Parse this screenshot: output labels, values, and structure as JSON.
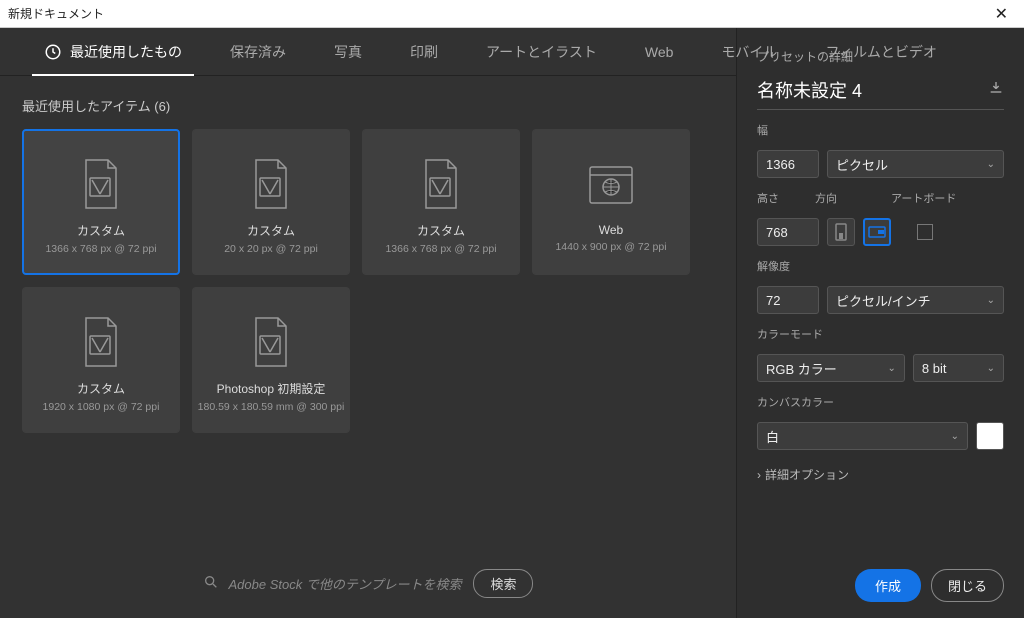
{
  "window": {
    "title": "新規ドキュメント"
  },
  "tabs": {
    "recent": "最近使用したもの",
    "saved": "保存済み",
    "photo": "写真",
    "print": "印刷",
    "art": "アートとイラスト",
    "web": "Web",
    "mobile": "モバイル",
    "film": "フィルムとビデオ"
  },
  "recentItems": {
    "heading": "最近使用したアイテム  (6)",
    "items": [
      {
        "title": "カスタム",
        "sub": "1366 x 768 px @ 72 ppi",
        "kind": "custom"
      },
      {
        "title": "カスタム",
        "sub": "20 x 20 px @ 72 ppi",
        "kind": "custom"
      },
      {
        "title": "カスタム",
        "sub": "1366 x 768 px @ 72 ppi",
        "kind": "custom"
      },
      {
        "title": "Web",
        "sub": "1440 x 900 px @ 72 ppi",
        "kind": "web"
      },
      {
        "title": "カスタム",
        "sub": "1920 x 1080 px @ 72 ppi",
        "kind": "custom"
      },
      {
        "title": "Photoshop 初期設定",
        "sub": "180.59 x 180.59 mm @ 300 ppi",
        "kind": "custom"
      }
    ]
  },
  "search": {
    "placeholder": "Adobe Stock で他のテンプレートを検索",
    "button": "検索"
  },
  "preset": {
    "heading": "プリセットの詳細",
    "name": "名称未設定 4",
    "widthLabel": "幅",
    "width": "1366",
    "unit": "ピクセル",
    "heightLabel": "高さ",
    "height": "768",
    "orientLabel": "方向",
    "artboardLabel": "アートボード",
    "resLabel": "解像度",
    "resolution": "72",
    "resUnit": "ピクセル/インチ",
    "colorModeLabel": "カラーモード",
    "colorMode": "RGB カラー",
    "bitDepth": "8 bit",
    "bgLabel": "カンバスカラー",
    "bg": "白",
    "advanced": "詳細オプション",
    "create": "作成",
    "close": "閉じる"
  }
}
